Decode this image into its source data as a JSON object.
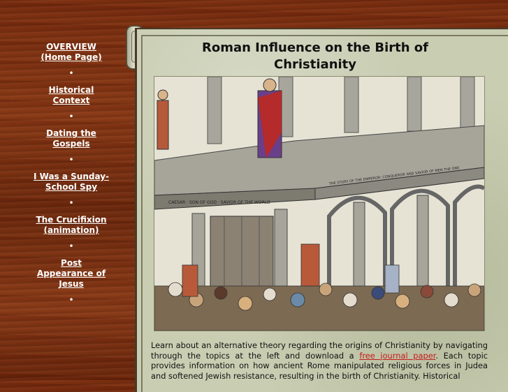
{
  "sidebar": {
    "items": [
      {
        "line1": "OVERVIEW",
        "line2": "(Home Page)"
      },
      {
        "line1": "Historical",
        "line2": "Context"
      },
      {
        "line1": "Dating the",
        "line2": "Gospels"
      },
      {
        "line1": "I Was a Sunday-",
        "line2": "School Spy"
      },
      {
        "line1": "The Crucifixion",
        "line2": "(animation)"
      },
      {
        "line1": "Post",
        "line2": "Appearance of",
        "line3": "Jesus"
      }
    ],
    "bullet": "•"
  },
  "main": {
    "title_line1": "Roman Influence on the Birth of",
    "title_line2": "Christianity",
    "intro_before_link": "Learn about an alternative theory regarding the origins of Christianity by navigating through the topics at the left and download a ",
    "intro_link": "free journal paper",
    "intro_after_link": ". Each topic provides information on how ancient Rome manipulated religious forces in Judea and softened Jewish resistance, resulting in the birth of Christianity. Historical",
    "frieze_text_upper": "THE STORY OF THE EMPEROR: CONQUEROR AND SAVIOR OF MEN THE ONE",
    "frieze_text_lower": "CAESAR · SON OF GOD · SAVIOR OF THE WORLD"
  },
  "colors": {
    "link": "#c41a1a",
    "nav_text": "#ffffff",
    "wood": "#7a2e10",
    "parchment": "#c9cdb2"
  }
}
